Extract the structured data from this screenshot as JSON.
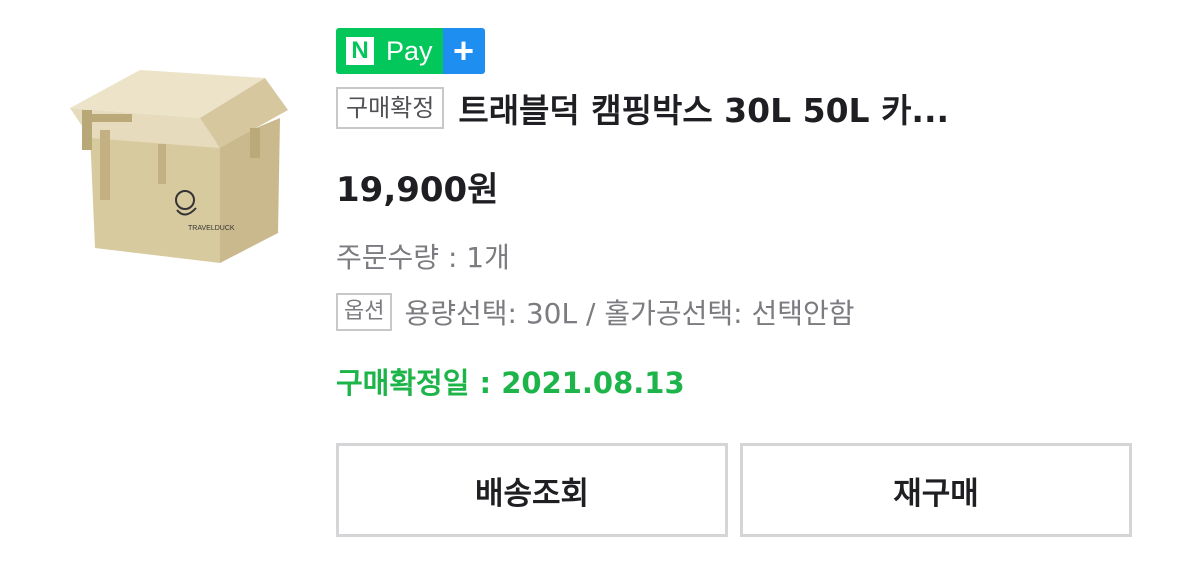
{
  "badge": {
    "n_letter": "N",
    "pay_text": "Pay",
    "plus": "+",
    "colors": {
      "green": "#03c75a",
      "blue": "#1f8ef1"
    }
  },
  "product": {
    "status_tag": "구매확정",
    "title": "트래블덕 캠핑박스 30L 50L 카...",
    "price": "19,900원",
    "quantity": "주문수량 : 1개",
    "option_tag": "옵션",
    "option_text": "용량선택: 30L / 홀가공선택: 선택안함",
    "confirm_date": "구매확정일 : 2021.08.13",
    "image_icon": "camping-box-image",
    "image_logo_text": "TRAVELDUCK"
  },
  "actions": {
    "tracking_label": "배송조회",
    "rebuy_label": "재구매"
  },
  "colors": {
    "confirm_green": "#1db44a",
    "text_dark": "#1e1e23",
    "text_gray": "#7b7b80",
    "border_gray": "#d5d5d8",
    "box_beige": "#dccfae"
  }
}
